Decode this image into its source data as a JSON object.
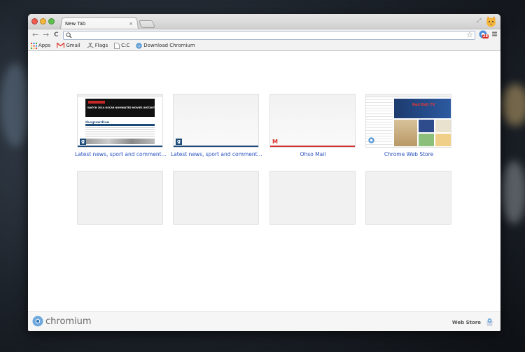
{
  "window": {
    "title": "New Tab"
  },
  "tab": {
    "title": "New Tab",
    "close_glyph": "×"
  },
  "toolbar": {
    "back_glyph": "←",
    "forward_glyph": "→",
    "reload_glyph": "C",
    "address_value": "",
    "star_glyph": "☆",
    "extension_badge": "28",
    "menu_glyph": "≡"
  },
  "bookmarks": [
    {
      "label": "Apps",
      "icon": "apps-grid-icon"
    },
    {
      "label": "Gmail",
      "icon": "gmail-icon"
    },
    {
      "label": "Flags",
      "icon": "flags-icon"
    },
    {
      "label": "C:C",
      "icon": "document-icon"
    },
    {
      "label": "Download Chromium",
      "icon": "chromium-icon"
    }
  ],
  "most_visited": [
    {
      "label": "Latest news, sport and comment...",
      "kind": "guardian-full",
      "accent": "#1c4b7a"
    },
    {
      "label": "Latest news, sport and comment...",
      "kind": "guardian-blank",
      "accent": "#1c4b7a"
    },
    {
      "label": "Ohso Mail",
      "kind": "mail",
      "accent": "#d32f2f"
    },
    {
      "label": "Chrome Web Store",
      "kind": "webstore",
      "accent": "#ffffff"
    },
    {
      "label": "",
      "kind": "empty"
    },
    {
      "label": "",
      "kind": "empty"
    },
    {
      "label": "",
      "kind": "empty"
    },
    {
      "label": "",
      "kind": "empty"
    }
  ],
  "thumbnail_text": {
    "guardian_banner": "WATCH 2014 OSCAR NOMINATED MOVIES INSTANTLY",
    "guardian_logo": "theguardian",
    "guardian_g": "g",
    "mail_m": "M",
    "webstore_hero": "Red Bull TV"
  },
  "footer": {
    "brand": "chromium",
    "webstore": "Web Store"
  },
  "colors": {
    "accent_blue": "#2a52be",
    "gmail_red": "#d93025",
    "badge_red": "#d93025"
  }
}
